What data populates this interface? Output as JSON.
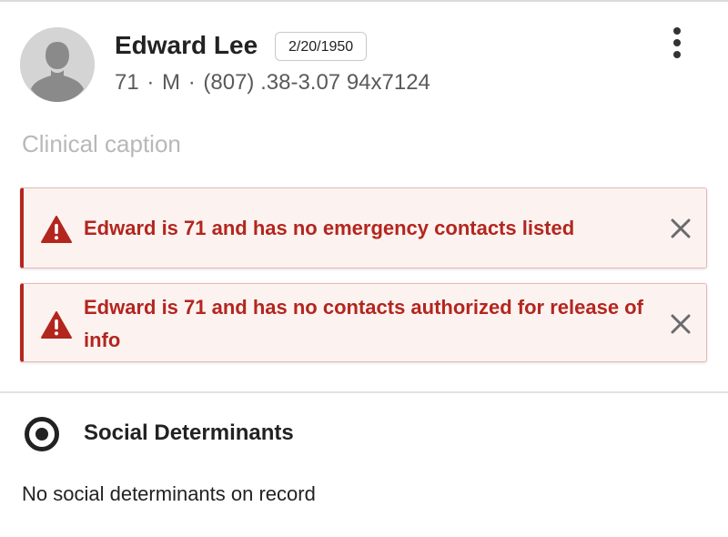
{
  "patient": {
    "name": "Edward Lee",
    "dob": "2/20/1950",
    "age": "71",
    "sex": "M",
    "phone": "(807) .38-3.07 94x7124",
    "separator": "·"
  },
  "caption_placeholder": "Clinical caption",
  "alerts": [
    {
      "message": "Edward is 71 and has no emergency contacts listed",
      "icon": "warning-icon"
    },
    {
      "message": "Edward is 71 and has no contacts authorized for release of info",
      "icon": "warning-icon"
    }
  ],
  "social_determinants": {
    "title": "Social Determinants",
    "empty_text": "No social determinants on record",
    "icon": "target-icon"
  },
  "colors": {
    "alert_text": "#b3261e",
    "alert_bg": "#fcf3f1",
    "alert_border": "#e9b7b2"
  }
}
